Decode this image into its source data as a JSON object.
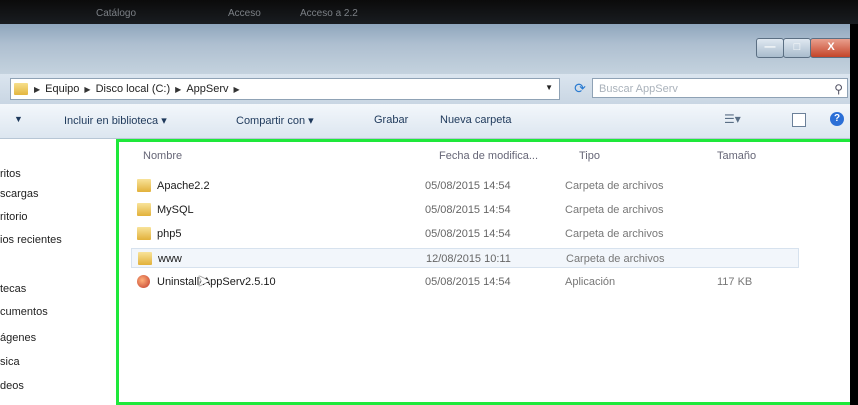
{
  "desktop": {
    "texts": [
      "Catálogo",
      "Acceso",
      "Acceso a 2.2"
    ]
  },
  "window": {
    "controls": {
      "minimize": "—",
      "maximize": "□",
      "close": "X"
    },
    "address": {
      "crumbs": [
        "Equipo",
        "Disco local (C:)",
        "AppServ"
      ]
    },
    "search": {
      "placeholder": "Buscar AppServ"
    },
    "toolbar": {
      "include": "Incluir en biblioteca ▾",
      "share": "Compartir con ▾",
      "burn": "Grabar",
      "new_folder": "Nueva carpeta"
    },
    "nav": [
      "ritos",
      "scargas",
      "ritorio",
      "ios recientes",
      "tecas",
      "cumentos",
      "ágenes",
      "sica",
      "deos"
    ],
    "columns": {
      "name": "Nombre",
      "date": "Fecha de modifica...",
      "type": "Tipo",
      "size": "Tamaño"
    },
    "files": [
      {
        "name": "Apache2.2",
        "date": "05/08/2015 14:54",
        "type": "Carpeta de archivos",
        "size": "",
        "icon": "folder-icon"
      },
      {
        "name": "MySQL",
        "date": "05/08/2015 14:54",
        "type": "Carpeta de archivos",
        "size": "",
        "icon": "folder-icon"
      },
      {
        "name": "php5",
        "date": "05/08/2015 14:54",
        "type": "Carpeta de archivos",
        "size": "",
        "icon": "folder-icon"
      },
      {
        "name": "www",
        "date": "12/08/2015 10:11",
        "type": "Carpeta de archivos",
        "size": "",
        "icon": "folder-icon"
      },
      {
        "name": "Uninstall-AppServ2.5.10",
        "date": "05/08/2015 14:54",
        "type": "Aplicación",
        "size": "117 KB",
        "icon": "app-icon"
      }
    ]
  },
  "colors": {
    "highlight_border": "#1ee83a",
    "title_bar": "#aebfd0"
  }
}
